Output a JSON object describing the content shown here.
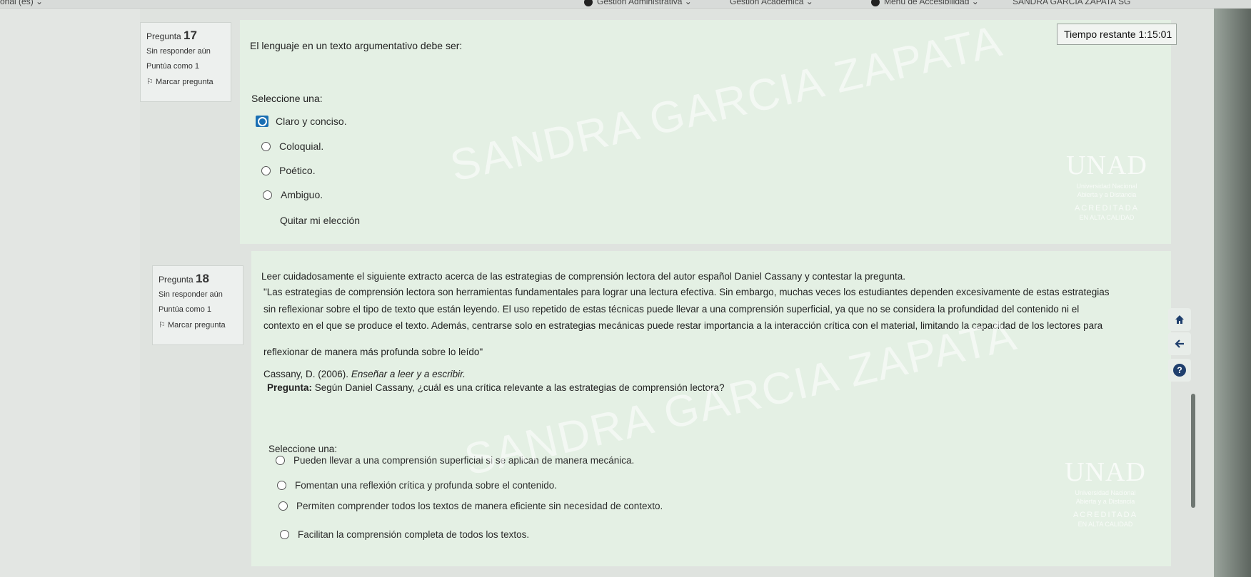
{
  "topbar": {
    "lang": "onal (es)",
    "gestion_admin": "Gestión Administrativa",
    "gestion_acad": "Gestión Académica",
    "menu_acc": "Menú de Accesibilidad",
    "user": "SANDRA GARCIA ZAPATA",
    "user_initials": "SG"
  },
  "timer": {
    "label": "Tiempo restante",
    "value": "1:15:01"
  },
  "q17": {
    "label": "Pregunta",
    "number": "17",
    "status": "Sin responder aún",
    "score": "Puntúa como 1",
    "flag": "Marcar pregunta",
    "text": "El lenguaje en un texto argumentativo debe ser:",
    "select_label": "Seleccione una:",
    "options": [
      "Claro y conciso.",
      "Coloquial.",
      "Poético.",
      "Ambiguo."
    ],
    "clear": "Quitar mi elección"
  },
  "q18": {
    "label": "Pregunta",
    "number": "18",
    "status": "Sin responder aún",
    "score": "Puntúa como 1",
    "flag": "Marcar pregunta",
    "intro": "Leer cuidadosamente el siguiente extracto acerca de las estrategias de comprensión lectora del autor español Daniel Cassany y contestar la pregunta.",
    "quote_lines": [
      "\"Las estrategias de comprensión lectora son herramientas fundamentales para lograr una lectura efectiva. Sin embargo, muchas veces los estudiantes dependen excesivamente de estas estrategias",
      "sin reflexionar sobre el tipo de texto que están leyendo. El uso repetido de estas técnicas puede llevar a una comprensión superficial, ya que no se considera la profundidad del contenido ni el",
      "contexto en el que se produce el texto. Además, centrarse solo en estrategias mecánicas puede restar importancia a la interacción crítica con el material, limitando la capacidad de los lectores para",
      "reflexionar de manera más profunda sobre lo leído\""
    ],
    "citation_plain": "Cassany, D. (2006). ",
    "citation_italic": "Enseñar a leer y a escribir.",
    "question_bold": "Pregunta:",
    "question_text": " Según Daniel Cassany, ¿cuál es una crítica relevante a las estrategias de comprensión lectora?",
    "select_label": "Seleccione una:",
    "options": [
      "Pueden llevar a una comprensión superficial si se aplican de manera mecánica.",
      "Fomentan una reflexión crítica y profunda sobre el contenido.",
      "Permiten comprender todos los textos de manera eficiente sin necesidad de contexto.",
      "Facilitan la comprensión completa de todos los textos."
    ]
  },
  "watermark": "SANDRA GARCIA ZAPATA",
  "unad": {
    "logo": "UNAD",
    "sub1": "Universidad Nacional",
    "sub2": "Abierta y a Distancia",
    "acc": "ACREDITADA",
    "acc2": "EN ALTA CALIDAD"
  },
  "icons": {
    "home": "home-icon",
    "back": "arrow-left-icon",
    "help": "help-icon"
  },
  "help_glyph": "?"
}
